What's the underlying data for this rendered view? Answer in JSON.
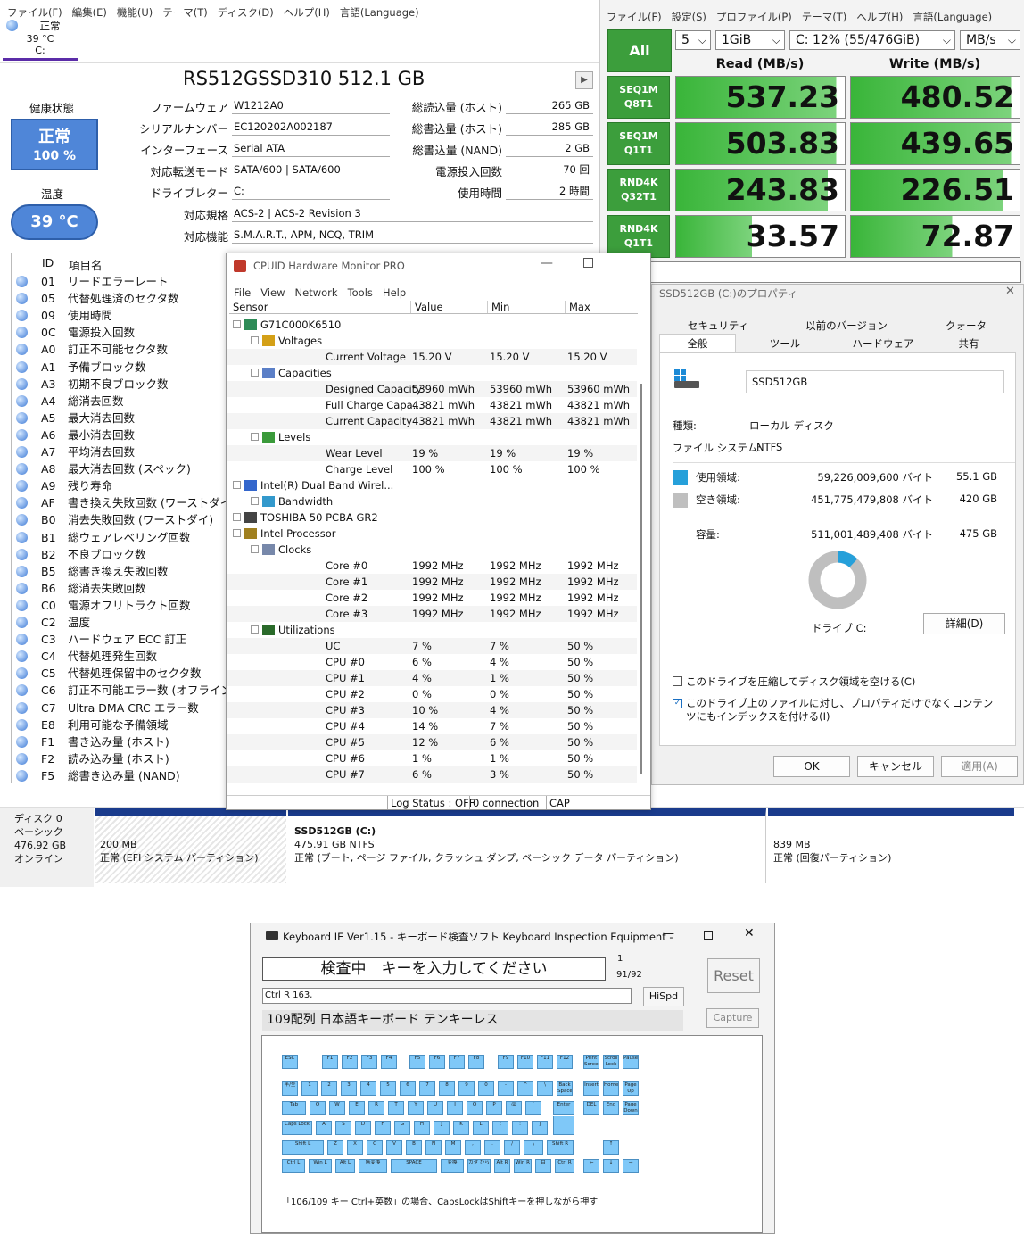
{
  "cdi": {
    "menu": [
      "ファイル(F)",
      "編集(E)",
      "機能(U)",
      "テーマ(T)",
      "ディスク(D)",
      "ヘルプ(H)",
      "言語(Language)"
    ],
    "tab": {
      "status": "正常",
      "temp": "39 °C",
      "drive": "C:"
    },
    "model": "RS512GSSD310 512.1 GB",
    "health_label": "健康状態",
    "health_status": "正常",
    "health_pct": "100 %",
    "temp_label": "温度",
    "temp_value": "39 °C",
    "fields": {
      "fw_label": "ファームウェア",
      "fw": "W1212A0",
      "sn_label": "シリアルナンバー",
      "sn": "EC120202A002187",
      "if_label": "インターフェース",
      "if": "Serial ATA",
      "mode_label": "対応転送モード",
      "mode": "SATA/600 | SATA/600",
      "letter_label": "ドライブレター",
      "letter": "C:",
      "std_label": "対応規格",
      "std": "ACS-2 | ACS-2 Revision 3",
      "feat_label": "対応機能",
      "feat": "S.M.A.R.T., APM, NCQ, TRIM",
      "hr_label": "総読込量 (ホスト)",
      "hr": "265 GB",
      "hw_label": "総書込量 (ホスト)",
      "hw": "285 GB",
      "nw_label": "総書込量 (NAND)",
      "nw": "2 GB",
      "pc_label": "電源投入回数",
      "pc": "70 回",
      "ph_label": "使用時間",
      "ph": "2 時間"
    },
    "smart_header": {
      "id": "ID",
      "name": "項目名"
    },
    "smart": [
      {
        "id": "01",
        "name": "リードエラーレート"
      },
      {
        "id": "05",
        "name": "代替処理済のセクタ数"
      },
      {
        "id": "09",
        "name": "使用時間"
      },
      {
        "id": "0C",
        "name": "電源投入回数"
      },
      {
        "id": "A0",
        "name": "訂正不可能セクタ数"
      },
      {
        "id": "A1",
        "name": "予備ブロック数"
      },
      {
        "id": "A3",
        "name": "初期不良ブロック数"
      },
      {
        "id": "A4",
        "name": "総消去回数"
      },
      {
        "id": "A5",
        "name": "最大消去回数"
      },
      {
        "id": "A6",
        "name": "最小消去回数"
      },
      {
        "id": "A7",
        "name": "平均消去回数"
      },
      {
        "id": "A8",
        "name": "最大消去回数 (スペック)"
      },
      {
        "id": "A9",
        "name": "残り寿命"
      },
      {
        "id": "AF",
        "name": "書き換え失敗回数 (ワーストダイ)"
      },
      {
        "id": "B0",
        "name": "消去失敗回数 (ワーストダイ)"
      },
      {
        "id": "B1",
        "name": "総ウェアレベリング回数"
      },
      {
        "id": "B2",
        "name": "不良ブロック数"
      },
      {
        "id": "B5",
        "name": "総書き換え失敗回数"
      },
      {
        "id": "B6",
        "name": "総消去失敗回数"
      },
      {
        "id": "C0",
        "name": "電源オフリトラクト回数"
      },
      {
        "id": "C2",
        "name": "温度"
      },
      {
        "id": "C3",
        "name": "ハードウェア ECC 訂正"
      },
      {
        "id": "C4",
        "name": "代替処理発生回数"
      },
      {
        "id": "C5",
        "name": "代替処理保留中のセクタ数"
      },
      {
        "id": "C6",
        "name": "訂正不可能エラー数 (オフライン)"
      },
      {
        "id": "C7",
        "name": "Ultra DMA CRC エラー数"
      },
      {
        "id": "E8",
        "name": "利用可能な予備領域"
      },
      {
        "id": "F1",
        "name": "書き込み量 (ホスト)"
      },
      {
        "id": "F2",
        "name": "読み込み量 (ホスト)"
      },
      {
        "id": "F5",
        "name": "総書き込み量 (NAND)"
      }
    ]
  },
  "cdm": {
    "menu": [
      "ファイル(F)",
      "設定(S)",
      "プロファイル(P)",
      "テーマ(T)",
      "ヘルプ(H)",
      "言語(Language)"
    ],
    "all": "All",
    "count": "5",
    "size": "1GiB",
    "drive": "C: 12% (55/476GiB)",
    "unit": "MB/s",
    "read_hdr": "Read (MB/s)",
    "write_hdr": "Write (MB/s)",
    "rows": [
      {
        "l1": "SEQ1M",
        "l2": "Q8T1",
        "read": "537.23",
        "write": "480.52",
        "rfill": 0.95,
        "wfill": 0.95
      },
      {
        "l1": "SEQ1M",
        "l2": "Q1T1",
        "read": "503.83",
        "write": "439.65",
        "rfill": 0.95,
        "wfill": 0.95
      },
      {
        "l1": "RND4K",
        "l2": "Q32T1",
        "read": "243.83",
        "write": "226.51",
        "rfill": 0.9,
        "wfill": 0.9
      },
      {
        "l1": "RND4K",
        "l2": "Q1T1",
        "read": "33.57",
        "write": "72.87",
        "rfill": 0.45,
        "wfill": 0.6
      }
    ]
  },
  "hwm": {
    "title": "CPUID Hardware Monitor PRO",
    "menu": [
      "File",
      "View",
      "Network",
      "Tools",
      "Help"
    ],
    "cols": [
      "Sensor",
      "Value",
      "Min",
      "Max"
    ],
    "rows": [
      {
        "lvl": 0,
        "name": "G71C000K6510",
        "icon": "computer-icon"
      },
      {
        "lvl": 1,
        "name": "Voltages",
        "icon": "voltage-icon"
      },
      {
        "lvl": 2,
        "name": "Current Voltage",
        "v": "15.20 V",
        "mn": "15.20 V",
        "mx": "15.20 V"
      },
      {
        "lvl": 1,
        "name": "Capacities",
        "icon": "capacity-icon"
      },
      {
        "lvl": 2,
        "name": "Designed Capacity",
        "v": "53960 mWh",
        "mn": "53960 mWh",
        "mx": "53960 mWh"
      },
      {
        "lvl": 2,
        "name": "Full Charge Capa...",
        "v": "43821 mWh",
        "mn": "43821 mWh",
        "mx": "43821 mWh"
      },
      {
        "lvl": 2,
        "name": "Current Capacity",
        "v": "43821 mWh",
        "mn": "43821 mWh",
        "mx": "43821 mWh"
      },
      {
        "lvl": 1,
        "name": "Levels",
        "icon": "levels-icon"
      },
      {
        "lvl": 2,
        "name": "Wear Level",
        "v": "19 %",
        "mn": "19 %",
        "mx": "19 %"
      },
      {
        "lvl": 2,
        "name": "Charge Level",
        "v": "100 %",
        "mn": "100 %",
        "mx": "100 %"
      },
      {
        "lvl": 0,
        "name": "Intel(R) Dual Band Wirel...",
        "icon": "network-icon"
      },
      {
        "lvl": 1,
        "name": "Bandwidth",
        "icon": "wifi-icon"
      },
      {
        "lvl": 0,
        "name": "TOSHIBA 50 PCBA GR2",
        "icon": "monitor-icon"
      },
      {
        "lvl": 0,
        "name": "Intel Processor",
        "icon": "cpu-icon"
      },
      {
        "lvl": 1,
        "name": "Clocks",
        "icon": "clock-icon"
      },
      {
        "lvl": 2,
        "name": "Core #0",
        "v": "1992 MHz",
        "mn": "1992 MHz",
        "mx": "1992 MHz"
      },
      {
        "lvl": 2,
        "name": "Core #1",
        "v": "1992 MHz",
        "mn": "1992 MHz",
        "mx": "1992 MHz"
      },
      {
        "lvl": 2,
        "name": "Core #2",
        "v": "1992 MHz",
        "mn": "1992 MHz",
        "mx": "1992 MHz"
      },
      {
        "lvl": 2,
        "name": "Core #3",
        "v": "1992 MHz",
        "mn": "1992 MHz",
        "mx": "1992 MHz"
      },
      {
        "lvl": 1,
        "name": "Utilizations",
        "icon": "utilization-icon"
      },
      {
        "lvl": 2,
        "name": "UC",
        "v": "7 %",
        "mn": "7 %",
        "mx": "50 %"
      },
      {
        "lvl": 2,
        "name": "CPU #0",
        "v": "6 %",
        "mn": "4 %",
        "mx": "50 %"
      },
      {
        "lvl": 2,
        "name": "CPU #1",
        "v": "4 %",
        "mn": "1 %",
        "mx": "50 %"
      },
      {
        "lvl": 2,
        "name": "CPU #2",
        "v": "0 %",
        "mn": "0 %",
        "mx": "50 %"
      },
      {
        "lvl": 2,
        "name": "CPU #3",
        "v": "10 %",
        "mn": "4 %",
        "mx": "50 %"
      },
      {
        "lvl": 2,
        "name": "CPU #4",
        "v": "14 %",
        "mn": "7 %",
        "mx": "50 %"
      },
      {
        "lvl": 2,
        "name": "CPU #5",
        "v": "12 %",
        "mn": "6 %",
        "mx": "50 %"
      },
      {
        "lvl": 2,
        "name": "CPU #6",
        "v": "1 %",
        "mn": "1 %",
        "mx": "50 %"
      },
      {
        "lvl": 2,
        "name": "CPU #7",
        "v": "6 %",
        "mn": "3 %",
        "mx": "50 %"
      }
    ],
    "status": [
      "Log Status : OFF",
      "0 connection",
      "CAP"
    ]
  },
  "props": {
    "title": "SSD512GB (C:)のプロパティ",
    "tabs_row1": [
      "セキュリティ",
      "以前のバージョン",
      "クォータ"
    ],
    "tabs_row2": [
      "全般",
      "ツール",
      "ハードウェア",
      "共有"
    ],
    "name": "SSD512GB",
    "type_label": "種類:",
    "type": "ローカル ディスク",
    "fs_label": "ファイル システム:",
    "fs": "NTFS",
    "used_label": "使用領域:",
    "used_bytes": "59,226,009,600 バイト",
    "used_gb": "55.1 GB",
    "free_label": "空き領域:",
    "free_bytes": "451,775,479,808 バイト",
    "free_gb": "420 GB",
    "cap_label": "容量:",
    "cap_bytes": "511,001,489,408 バイト",
    "cap_gb": "475 GB",
    "used_fraction": 0.12,
    "drive_label": "ドライブ C:",
    "detail": "詳細(D)",
    "compress": "このドライブを圧縮してディスク領域を空ける(C)",
    "index": "このドライブ上のファイルに対し、プロパティだけでなくコンテンツにもインデックスを付ける(I)",
    "ok": "OK",
    "cancel": "キャンセル",
    "apply": "適用(A)",
    "used_color": "#26a0da",
    "free_color": "#bfbfbf"
  },
  "disk": {
    "d_label": "ディスク 0",
    "d_type": "ベーシック",
    "d_size": "476.92 GB",
    "d_state": "オンライン",
    "p1_size": "200 MB",
    "p1_desc": "正常 (EFI システム パーティション)",
    "p2_name": "SSD512GB (C:)",
    "p2_size": "475.91 GB NTFS",
    "p2_desc": "正常 (ブート, ページ ファイル, クラッシュ ダンプ, ベーシック データ パーティション)",
    "p3_size": "839 MB",
    "p3_desc": "正常 (回復パーティション)"
  },
  "kb": {
    "title": "Keyboard IE Ver1.15 - キーボード検査ソフト Keyboard Inspection Equipment -",
    "status": "検査中　キーを入力してください",
    "count1": "1",
    "count2": "91/92",
    "reset": "Reset",
    "last": "Ctrl R 163,",
    "hispd": "HiSpd",
    "layout": "109配列 日本語キーボード テンキーレス",
    "capture": "Capture",
    "note": "「106/109 キー Ctrl+英数」の場合、CapsLockはShiftキーを押しながら押す",
    "keys_row0": [
      "ESC",
      "F1",
      "F2",
      "F3",
      "F4",
      "F5",
      "F6",
      "F7",
      "F8",
      "F9",
      "F10",
      "F11",
      "F12",
      "Print Screen",
      "Scroll Lock",
      "Pause"
    ],
    "keys_row1": [
      "半/全",
      "1",
      "2",
      "3",
      "4",
      "5",
      "6",
      "7",
      "8",
      "9",
      "0",
      "-",
      "^",
      "\\",
      "Back Space",
      "Insert",
      "Home",
      "Page Up"
    ],
    "keys_row2": [
      "Tab",
      "Q",
      "W",
      "E",
      "R",
      "T",
      "Y",
      "U",
      "I",
      "O",
      "P",
      "@",
      "[",
      "Enter",
      "DEL",
      "End",
      "Page Down"
    ],
    "keys_row3": [
      "Caps Lock",
      "A",
      "S",
      "D",
      "F",
      "G",
      "H",
      "J",
      "K",
      "L",
      ";",
      ":",
      "]"
    ],
    "keys_row4": [
      "Shift L",
      "Z",
      "X",
      "C",
      "V",
      "B",
      "N",
      "M",
      ",",
      ".",
      "/",
      "\\",
      "Shift R",
      "↑"
    ],
    "keys_row5": [
      "Ctrl L",
      "Win L",
      "Alt L",
      "無変換",
      "SPACE",
      "変換",
      "カタ ひら",
      "Alt R",
      "Win R",
      "目",
      "Ctrl R",
      "←",
      "↓",
      "→"
    ]
  }
}
